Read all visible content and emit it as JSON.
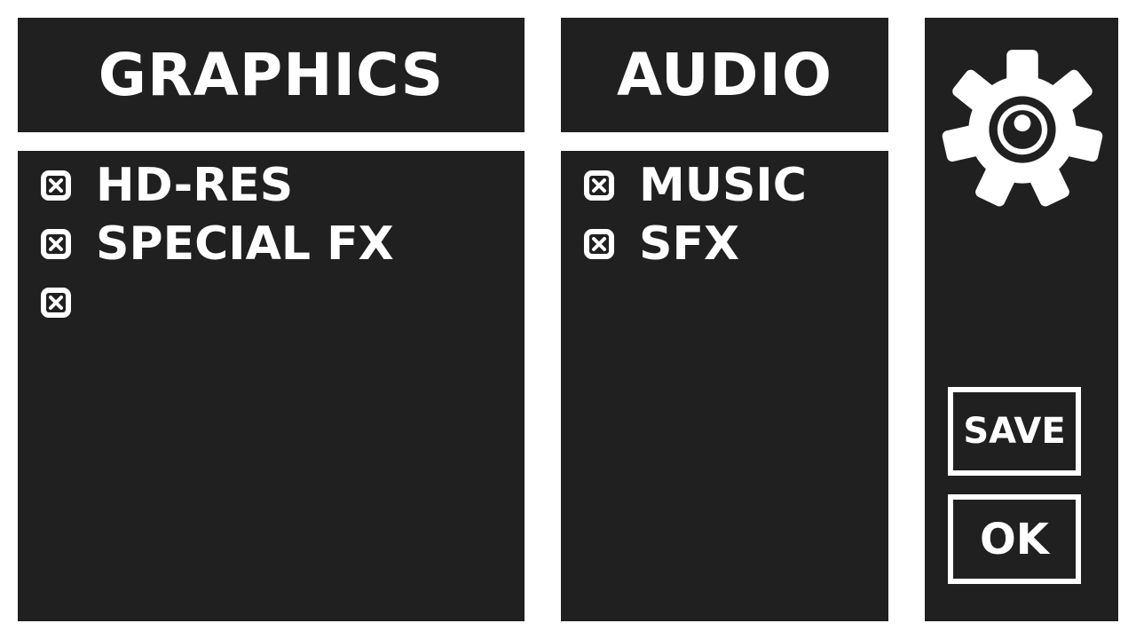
{
  "graphics": {
    "title": "GRAPHICS",
    "options": [
      {
        "label": "HD-RES",
        "checked": true
      },
      {
        "label": "SPECIAL FX",
        "checked": true
      },
      {
        "label": "",
        "checked": true
      }
    ]
  },
  "audio": {
    "title": "AUDIO",
    "options": [
      {
        "label": "MUSIC",
        "checked": true
      },
      {
        "label": "SFX",
        "checked": true
      }
    ]
  },
  "side": {
    "icon": "gear-icon",
    "save_label": "SAVE",
    "ok_label": "OK"
  },
  "colors": {
    "panel": "#202020",
    "text": "#ffffff",
    "background": "#ffffff"
  }
}
